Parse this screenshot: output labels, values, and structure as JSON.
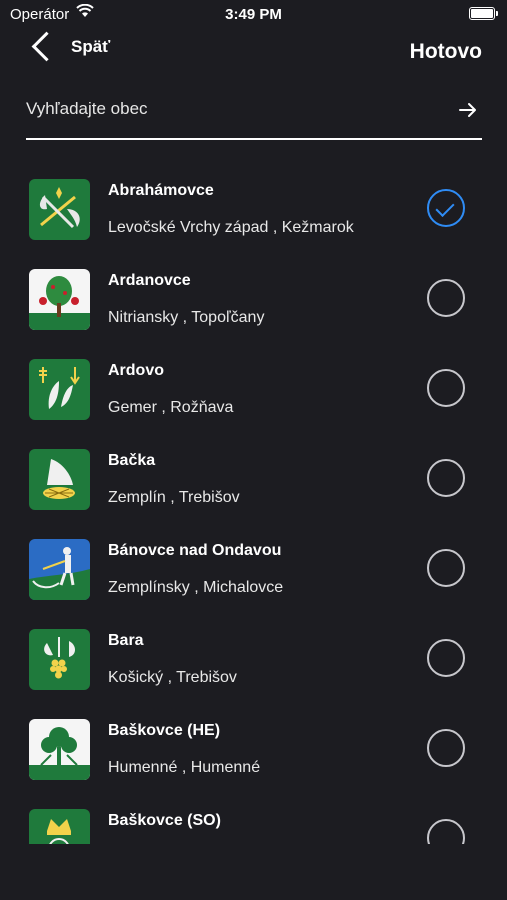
{
  "status_bar": {
    "carrier": "Operátor",
    "time": "3:49 PM"
  },
  "nav": {
    "back_label": "Späť",
    "done_label": "Hotovo"
  },
  "search": {
    "placeholder": "Vyhľadajte obec",
    "value": ""
  },
  "colors": {
    "accent": "#2f8cf5",
    "background": "#1c1c21",
    "crest_green": "#1f7a3c"
  },
  "municipalities": [
    {
      "name": "Abrahámovce",
      "region": "Levočské Vrchy západ , Kežmarok",
      "selected": true,
      "crest_icon": "crest-axe-icon"
    },
    {
      "name": "Ardanovce",
      "region": "Nitriansky , Topoľčany",
      "selected": false,
      "crest_icon": "crest-tree-icon"
    },
    {
      "name": "Ardovo",
      "region": "Gemer , Rožňava",
      "selected": false,
      "crest_icon": "crest-feathers-icon"
    },
    {
      "name": "Bačka",
      "region": "Zemplín , Trebišov",
      "selected": false,
      "crest_icon": "crest-plow-icon"
    },
    {
      "name": "Bánovce nad Ondavou",
      "region": "Zemplínsky , Michalovce",
      "selected": false,
      "crest_icon": "crest-mower-icon"
    },
    {
      "name": "Bara",
      "region": "Košický , Trebišov",
      "selected": false,
      "crest_icon": "crest-grapes-icon"
    },
    {
      "name": "Baškovce (HE)",
      "region": "Humenné , Humenné",
      "selected": false,
      "crest_icon": "crest-oak-icon"
    },
    {
      "name": "Baškovce (SO)",
      "region": "",
      "selected": false,
      "crest_icon": "crest-crown-icon"
    }
  ]
}
